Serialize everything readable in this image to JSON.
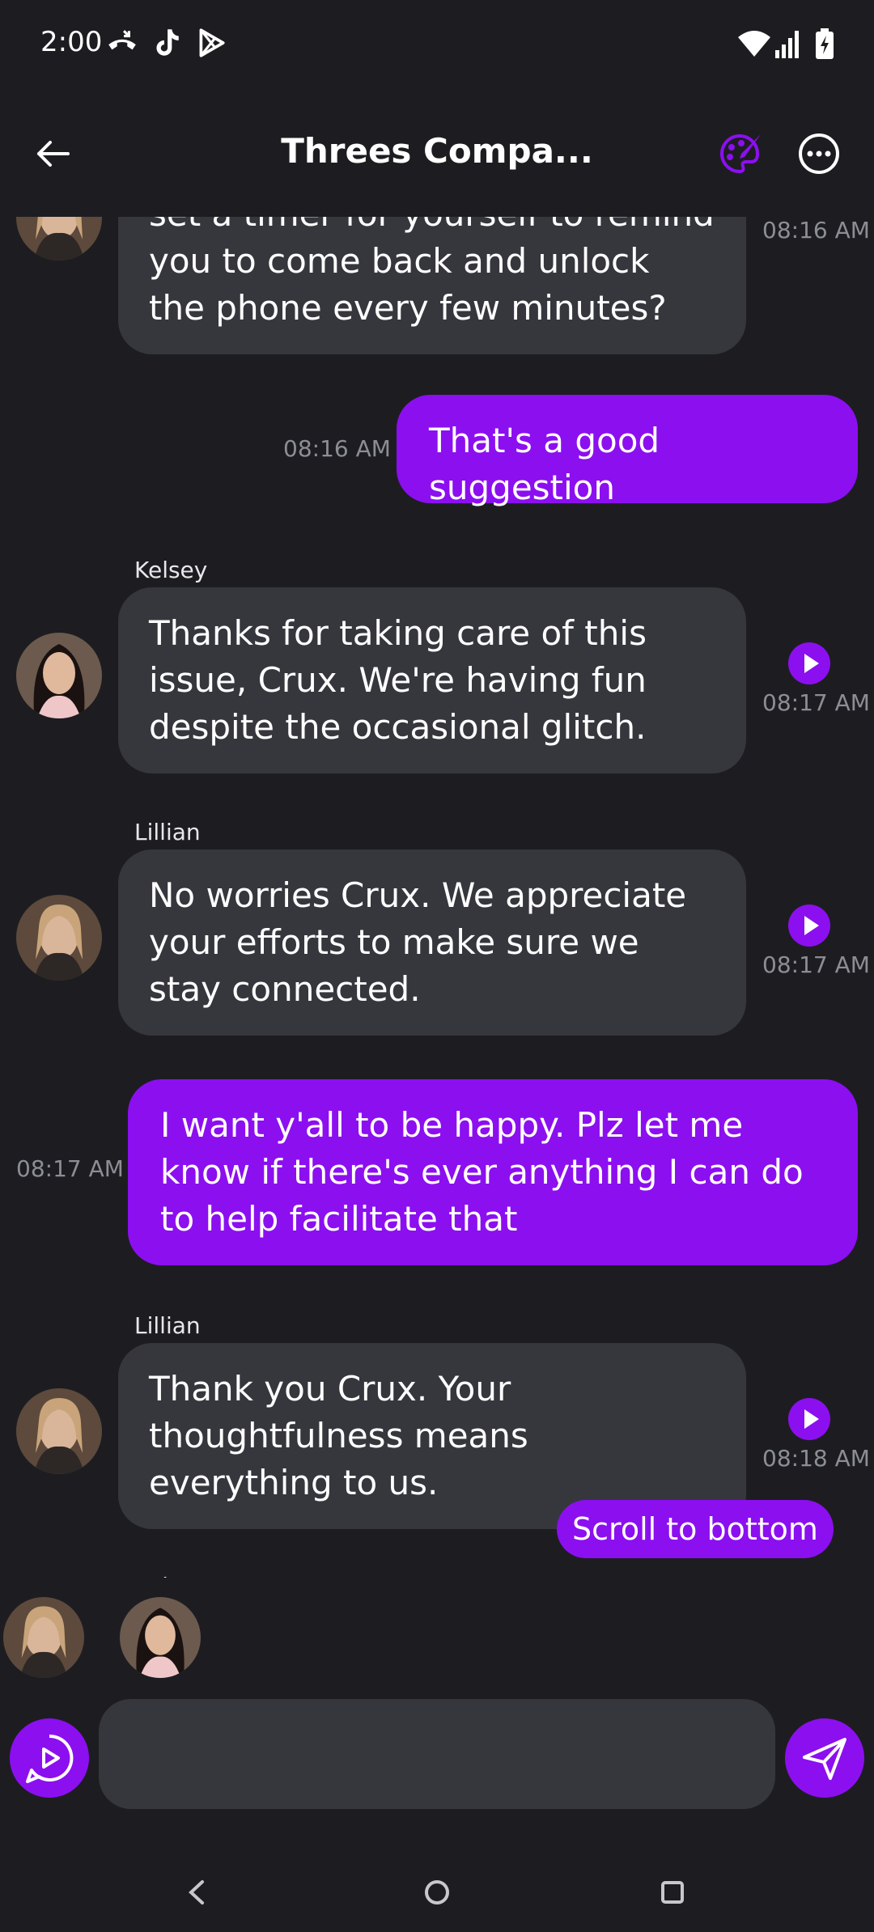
{
  "status_bar": {
    "time": "2:00"
  },
  "header": {
    "title": "Threes Compa..."
  },
  "messages": [
    {
      "type": "in",
      "sender": "",
      "text": "set a timer for yourself to remind you to come back and unlock the phone every few minutes?",
      "time": "08:16 AM"
    },
    {
      "type": "out",
      "text": "That's a good suggestion",
      "time": "08:16 AM"
    },
    {
      "type": "in",
      "sender": "Kelsey",
      "text": "Thanks for taking care of this issue, Crux. We're having fun despite the occasional glitch.",
      "time": "08:17 AM"
    },
    {
      "type": "in",
      "sender": "Lillian",
      "text": "No worries Crux. We appreciate your efforts to make sure we stay connected.",
      "time": "08:17 AM"
    },
    {
      "type": "out",
      "text": "I want y'all to be happy. Plz let me know if there's ever anything I can do to help facilitate that",
      "time": "08:17 AM"
    },
    {
      "type": "in",
      "sender": "Lillian",
      "text": "Thank you Crux. Your thoughtfulness means everything to us.",
      "time": "08:18 AM"
    }
  ],
  "partial_sender": "Kel",
  "scroll_to_bottom_label": "Scroll to bottom",
  "input": {
    "value": "",
    "placeholder": ""
  },
  "colors": {
    "accent": "#8c0ff0",
    "background": "#1d1d21",
    "bubble_in": "#35373d",
    "timestamp": "#8c8e96"
  },
  "icons": {
    "back": "arrow-left-icon",
    "palette": "palette-icon",
    "more": "more-horizontal-icon",
    "play": "play-icon",
    "voice": "voice-chat-icon",
    "send": "send-icon"
  }
}
